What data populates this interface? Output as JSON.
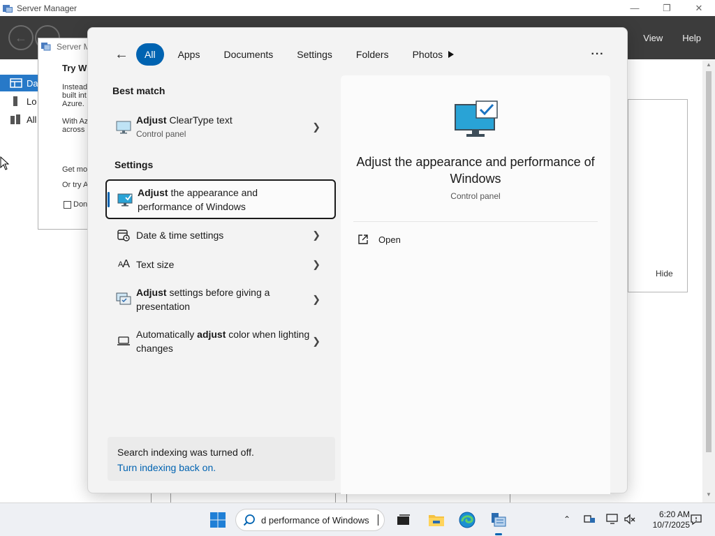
{
  "server_manager": {
    "title": "Server Manager",
    "menu": [
      "View",
      "Help"
    ],
    "sidebar": [
      {
        "label": "Da",
        "active": true
      },
      {
        "label": "Lo",
        "active": false
      },
      {
        "label": "All",
        "active": false
      }
    ],
    "panel_hide_label": "Hide",
    "dialog": {
      "title": "Server M",
      "heading": "Try Wi",
      "lines": [
        "Instead",
        "built int",
        "Azure.",
        "With Az",
        "across",
        "Get mo",
        "Or try A",
        "Don"
      ]
    }
  },
  "search_panel": {
    "filters": [
      {
        "label": "All",
        "active": true
      },
      {
        "label": "Apps",
        "active": false
      },
      {
        "label": "Documents",
        "active": false
      },
      {
        "label": "Settings",
        "active": false
      },
      {
        "label": "Folders",
        "active": false
      },
      {
        "label": "Photos",
        "active": false
      }
    ],
    "best_match_heading": "Best match",
    "best_match": {
      "title_bold": "Adjust",
      "title_rest": " ClearType text",
      "subtitle": "Control panel"
    },
    "settings_heading": "Settings",
    "settings_results": [
      {
        "bold": "Adjust",
        "rest": " the appearance and performance of Windows",
        "selected": true
      },
      {
        "pre": "Date & time settings",
        "selected": false
      },
      {
        "pre": "Text size",
        "selected": false
      },
      {
        "bold": "Adjust",
        "rest": " settings before giving a presentation",
        "selected": false
      },
      {
        "pre": "Automatically ",
        "bold": "adjust",
        "rest": " color when lighting changes",
        "selected": false
      }
    ],
    "indexing_message": "Search indexing was turned off.",
    "indexing_link": "Turn indexing back on.",
    "detail": {
      "title": "Adjust the appearance and performance of Windows",
      "subtitle": "Control panel",
      "action_open": "Open"
    }
  },
  "taskbar": {
    "search_value": "d performance of Windows",
    "time": "6:20 AM",
    "date": "10/7/2025"
  },
  "colors": {
    "accent": "#0063b1",
    "server_manager_header": "#3c3c3c",
    "sidebar_active": "#2779c8"
  }
}
